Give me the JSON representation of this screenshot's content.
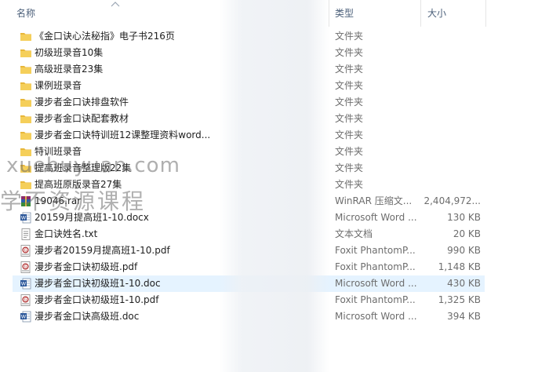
{
  "header": {
    "name_label": "名称",
    "type_label": "类型",
    "size_label": "大小"
  },
  "files": [
    {
      "name": "《金口诀心法秘指》电子书216页",
      "type": "文件夹",
      "size": "",
      "icon": "folder-icon"
    },
    {
      "name": "初级班录音10集",
      "type": "文件夹",
      "size": "",
      "icon": "folder-icon"
    },
    {
      "name": "高级班录音23集",
      "type": "文件夹",
      "size": "",
      "icon": "folder-icon"
    },
    {
      "name": "课例班录音",
      "type": "文件夹",
      "size": "",
      "icon": "folder-icon"
    },
    {
      "name": "漫步者金口诀排盘软件",
      "type": "文件夹",
      "size": "",
      "icon": "folder-icon"
    },
    {
      "name": "漫步者金口诀配套教材",
      "type": "文件夹",
      "size": "",
      "icon": "folder-icon"
    },
    {
      "name": "漫步者金口诀特训班12课整理资料word...",
      "type": "文件夹",
      "size": "",
      "icon": "folder-icon"
    },
    {
      "name": "特训班录音",
      "type": "文件夹",
      "size": "",
      "icon": "folder-icon"
    },
    {
      "name": "提高班录音整理版22集",
      "type": "文件夹",
      "size": "",
      "icon": "folder-icon"
    },
    {
      "name": "提高班原版录音27集",
      "type": "文件夹",
      "size": "",
      "icon": "folder-icon"
    },
    {
      "name": "19046.rar",
      "type": "WinRAR 压缩文...",
      "size": "2,404,972...",
      "icon": "winrar-archive-icon"
    },
    {
      "name": "20159月提高班1-10.docx",
      "type": "Microsoft Word ...",
      "size": "130 KB",
      "icon": "word-document-icon"
    },
    {
      "name": "金口诀姓名.txt",
      "type": "文本文档",
      "size": "20 KB",
      "icon": "text-file-icon"
    },
    {
      "name": "漫步者20159月提高班1-10.pdf",
      "type": "Foxit PhantomP...",
      "size": "990 KB",
      "icon": "pdf-file-icon"
    },
    {
      "name": "漫步者金口诀初级班.pdf",
      "type": "Foxit PhantomP...",
      "size": "1,148 KB",
      "icon": "pdf-file-icon"
    },
    {
      "name": "漫步者金口诀初级班1-10.doc",
      "type": "Microsoft Word ...",
      "size": "430 KB",
      "icon": "word-document-icon",
      "selected": true
    },
    {
      "name": "漫步者金口诀初级班1-10.pdf",
      "type": "Foxit PhantomP...",
      "size": "1,325 KB",
      "icon": "pdf-file-icon"
    },
    {
      "name": "漫步者金口诀高级班.doc",
      "type": "Microsoft Word ...",
      "size": "394 KB",
      "icon": "word-document-icon"
    }
  ],
  "watermark": {
    "line1": "xuebuyuan.com",
    "line2": "学不资源课程"
  },
  "colors": {
    "folder": "#f3c74f",
    "selection": "#e5f3ff",
    "header_text": "#4c607a",
    "word_blue": "#2b579a",
    "pdf_red": "#a33"
  }
}
